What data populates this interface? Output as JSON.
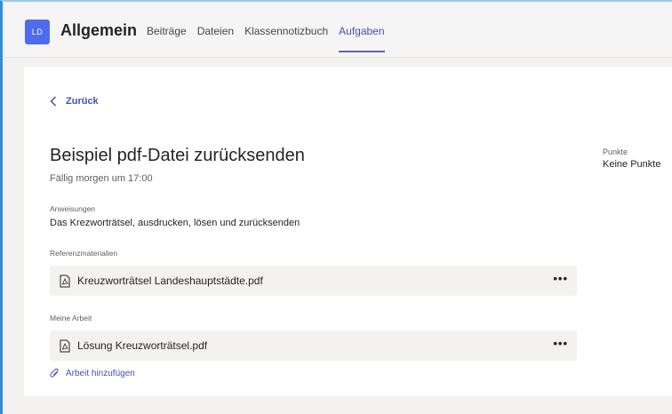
{
  "header": {
    "avatar_initials": "LD",
    "channel_title": "Allgemein",
    "tabs": [
      {
        "label": "Beiträge"
      },
      {
        "label": "Dateien"
      },
      {
        "label": "Klassennotizbuch"
      },
      {
        "label": "Aufgaben",
        "active": true
      }
    ]
  },
  "assignment": {
    "back_label": "Zurück",
    "title": "Beispiel pdf-Datei zurücksenden",
    "due": "Fällig morgen um 17:00",
    "instructions_label": "Anweisungen",
    "instructions_text": "Das Krezworträtsel, ausdrucken, lösen und zurücksenden",
    "reference_label": "Referenzmaterialien",
    "reference_file": "Kreuzworträtsel Landeshauptstädte.pdf",
    "my_work_label": "Meine Arbeit",
    "my_work_file": "Lösung Kreuzworträtsel.pdf",
    "add_work_label": "Arbeit hinzufügen",
    "more_label": "•••"
  },
  "points": {
    "label": "Punkte",
    "value": "Keine Punkte"
  },
  "colors": {
    "accent": "#464eb8",
    "avatar_bg": "#4f6bed",
    "frame_border": "#2f8fd8"
  },
  "icons": [
    "chevron-left-icon",
    "pdf-file-icon",
    "more-icon",
    "paperclip-icon"
  ]
}
